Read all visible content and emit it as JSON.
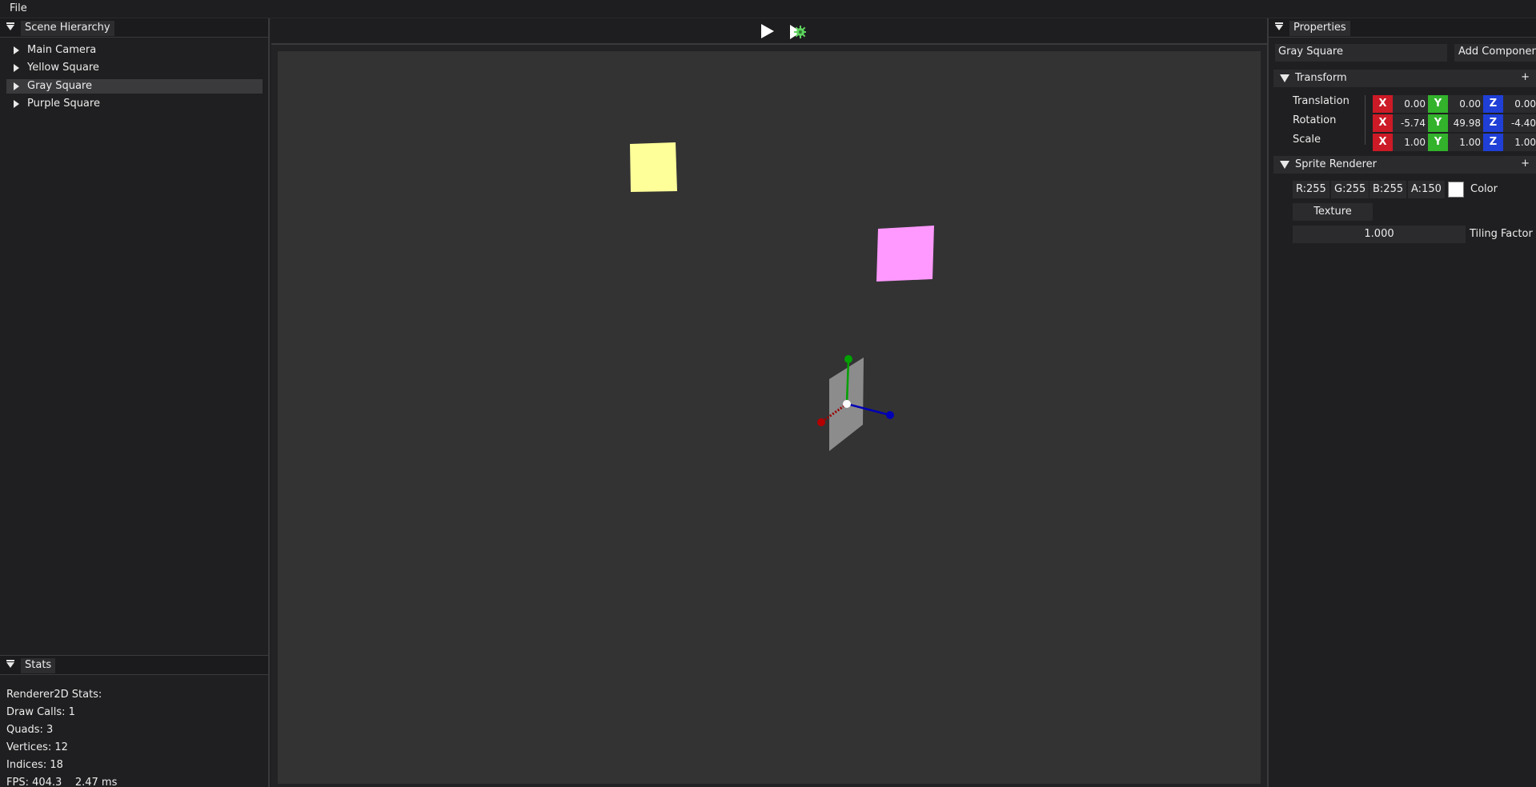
{
  "menubar": {
    "file_label": "File"
  },
  "hierarchy": {
    "title": "Scene Hierarchy",
    "items": [
      {
        "label": "Main Camera"
      },
      {
        "label": "Yellow Square"
      },
      {
        "label": "Gray Square"
      },
      {
        "label": "Purple Square"
      }
    ],
    "selected": "Gray Square"
  },
  "stats": {
    "title": "Stats",
    "heading": "Renderer2D Stats:",
    "draw_calls": "Draw Calls: 1",
    "quads": "Quads: 3",
    "vertices": "Vertices: 12",
    "indices": "Indices: 18",
    "fps": "FPS: 404.3    2.47 ms"
  },
  "toolbar": {
    "play_icon": "play-icon",
    "simulate_icon": "simulate-icon"
  },
  "viewport": {
    "background": "#333334",
    "entities": [
      {
        "name": "Yellow Square",
        "color": "#ffff99"
      },
      {
        "name": "Purple Square",
        "color": "#ff99ff"
      },
      {
        "name": "Gray Square",
        "color": "#8c8c8c"
      }
    ],
    "gizmo_colors": {
      "x": "#b40000",
      "y": "#00a000",
      "z": "#0000b4"
    }
  },
  "properties": {
    "title": "Properties",
    "entity_name": "Gray Square",
    "add_component_label": "Add Component",
    "transform": {
      "title": "Transform",
      "plus": "+",
      "axis_labels": {
        "x": "X",
        "y": "Y",
        "z": "Z"
      },
      "translation": {
        "label": "Translation",
        "x": "0.00",
        "y": "0.00",
        "z": "0.00"
      },
      "rotation": {
        "label": "Rotation",
        "x": "-5.74",
        "y": "49.98",
        "z": "-4.40"
      },
      "scale": {
        "label": "Scale",
        "x": "1.00",
        "y": "1.00",
        "z": "1.00"
      }
    },
    "sprite_renderer": {
      "title": "Sprite Renderer",
      "plus": "+",
      "r": "R:255",
      "g": "G:255",
      "b": "B:255",
      "a": "A:150",
      "color_label": "Color",
      "swatch": "#ffffff",
      "texture_label": "Texture",
      "tiling_value": "1.000",
      "tiling_label": "Tiling Factor"
    }
  }
}
